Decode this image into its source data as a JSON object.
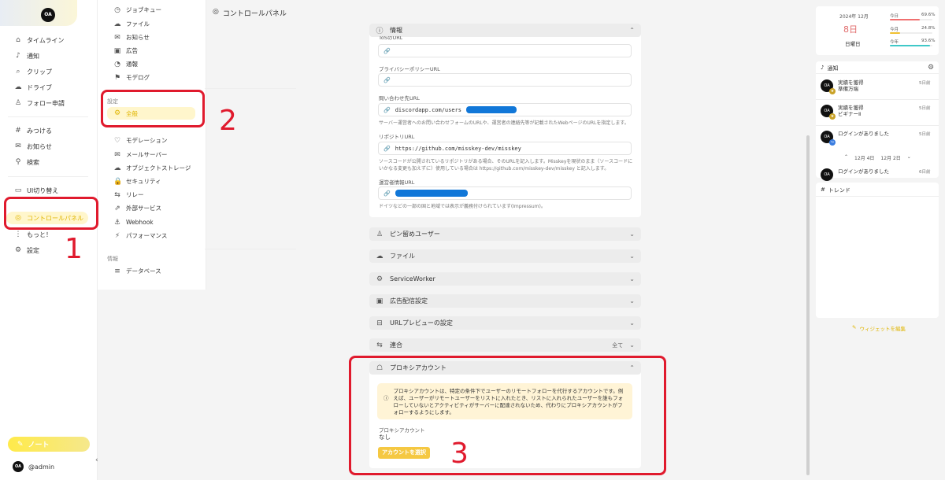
{
  "nav": {
    "logo_text": "OA",
    "items": [
      {
        "icon": "⌂",
        "label": "タイムライン"
      },
      {
        "icon": "♪",
        "label": "通知"
      },
      {
        "icon": "⌕",
        "label": "クリップ"
      },
      {
        "icon": "☁",
        "label": "ドライブ"
      },
      {
        "icon": "♙",
        "label": "フォロー申請"
      },
      {
        "icon": "#",
        "label": "みつける"
      },
      {
        "icon": "✉",
        "label": "お知らせ"
      },
      {
        "icon": "⚲",
        "label": "検索"
      },
      {
        "icon": "▭",
        "label": "UI切り替え"
      },
      {
        "icon": "◎",
        "label": "コントロールパネル"
      },
      {
        "icon": "⋮",
        "label": "もっと！"
      },
      {
        "icon": "⚙",
        "label": "設定"
      }
    ],
    "note_label": "ノート",
    "account_avatar": "OA",
    "account_name": "@admin"
  },
  "menu": {
    "items_top": [
      {
        "icon": "◷",
        "label": "ジョブキュー"
      },
      {
        "icon": "☁",
        "label": "ファイル"
      },
      {
        "icon": "✉",
        "label": "お知らせ"
      },
      {
        "icon": "▣",
        "label": "広告"
      },
      {
        "icon": "◔",
        "label": "通報"
      },
      {
        "icon": "⚑",
        "label": "モデログ"
      }
    ],
    "settings_header": "設定",
    "settings_items": [
      {
        "icon": "⚙",
        "label": "全般"
      },
      {
        "icon": "♡",
        "label": "モデレーション"
      },
      {
        "icon": "✉",
        "label": "メールサーバー"
      },
      {
        "icon": "☁",
        "label": "オブジェクトストレージ"
      },
      {
        "icon": "🔒",
        "label": "セキュリティ"
      },
      {
        "icon": "⇆",
        "label": "リレー"
      },
      {
        "icon": "⇗",
        "label": "外部サービス"
      },
      {
        "icon": "⚓",
        "label": "Webhook"
      },
      {
        "icon": "⚡",
        "label": "パフォーマンス"
      }
    ],
    "info_header": "情報",
    "info_items": [
      {
        "icon": "≡",
        "label": "データベース"
      }
    ]
  },
  "header": {
    "icon": "◎",
    "title": "コントロールパネル"
  },
  "info_section": {
    "title": "情報",
    "cut_label": "ToSのURL",
    "privacy_label": "プライバシーポリシーURL",
    "privacy_value": "",
    "inquiry_label": "問い合わせ先URL",
    "inquiry_value": "discordapp.com/users",
    "inquiry_hint": "サーバー運営者へのお問い合わせフォームのURLや、運営者の連絡先等が記載されたWebページのURLを指定します。",
    "repo_label": "リポジトリURL",
    "repo_value": "https://github.com/misskey-dev/misskey",
    "repo_hint": "ソースコードが公開されているリポジトリがある場合、そのURLを記入します。Misskeyを現状のまま（ソースコードにいかなる変更も加えずに）使用している場合は https://github.com/misskey-dev/misskey と記入します。",
    "impressum_label": "運営者情報URL",
    "impressum_hint": "ドイツなどの一部の国と地域では表示が義務付けられています(Impressum)。"
  },
  "sections": [
    {
      "icon": "♙",
      "label": "ピン留めユーザー"
    },
    {
      "icon": "☁",
      "label": "ファイル"
    },
    {
      "icon": "⚙",
      "label": "ServiceWorker"
    },
    {
      "icon": "▣",
      "label": "広告配信設定"
    },
    {
      "icon": "⊟",
      "label": "URLプレビューの設定"
    }
  ],
  "federation": {
    "icon": "⇆",
    "label": "連合",
    "value": "全て"
  },
  "proxy": {
    "title": "プロキシアカウント",
    "info": "プロキシアカウントは、特定の条件下でユーザーのリモートフォローを代行するアカウントです。例えば、ユーザーがリモートユーザーをリストに入れたとき、リストに入れられたユーザーを誰もフォローしていないとアクティビティがサーバーに配達されないため、代わりにプロキシアカウントがフォローするようにします。",
    "account_label": "プロキシアカウント",
    "account_value": "なし",
    "select_button": "アカウントを選択"
  },
  "calendar": {
    "year_month": "2024年 12月",
    "day": "8日",
    "weekday": "日曜日",
    "rows": [
      {
        "label": "今日",
        "value": "69.6%",
        "progress": 69.6,
        "color": "#f07070"
      },
      {
        "label": "今月",
        "value": "24.8%",
        "progress": 24.8,
        "color": "#f0c030"
      },
      {
        "label": "今年",
        "value": "93.6%",
        "progress": 93.6,
        "color": "#40c8c8"
      }
    ]
  },
  "notifications": {
    "title": "通知",
    "items": [
      {
        "avatar": "OA",
        "line1": "実績を獲得",
        "line2": "準備万端",
        "time": "5日前",
        "badge_color": "#c9a227"
      },
      {
        "avatar": "OA",
        "line1": "実績を獲得",
        "line2": "ビギナーⅡ",
        "time": "5日前",
        "badge_color": "#c9a227"
      },
      {
        "avatar": "OA",
        "line1": "ログインがありました",
        "line2": "",
        "time": "5日前",
        "badge_color": "#3a7de0"
      },
      {
        "avatar": "OA",
        "line1": "ログインがありました",
        "line2": "",
        "time": "6日前",
        "badge_color": "#3a7de0"
      }
    ],
    "date_prev": "12月 4日",
    "date_next": "12月 2日"
  },
  "trend": {
    "title": "トレンド"
  },
  "edit_widgets": "ウィジェットを編集",
  "colors": {
    "accent": "#e0b500",
    "annotation": "#e01a2d",
    "redaction": "#1177d8"
  },
  "annotations": [
    "1",
    "2",
    "3"
  ]
}
